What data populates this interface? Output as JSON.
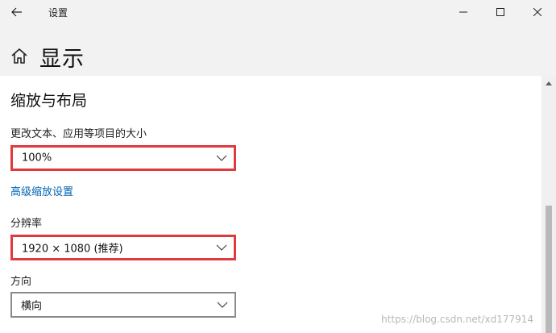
{
  "window": {
    "title": "设置"
  },
  "header": {
    "page_title": "显示"
  },
  "section": {
    "title": "缩放与布局"
  },
  "scale": {
    "label": "更改文本、应用等项目的大小",
    "value": "100%"
  },
  "advanced_link": "高级缩放设置",
  "resolution": {
    "label": "分辨率",
    "value": "1920 × 1080 (推荐)"
  },
  "orientation": {
    "label": "方向",
    "value": "横向"
  },
  "watermark": "https://blog.csdn.net/xd177914",
  "colors": {
    "highlight": "#e0393e",
    "link": "#0063b1"
  }
}
